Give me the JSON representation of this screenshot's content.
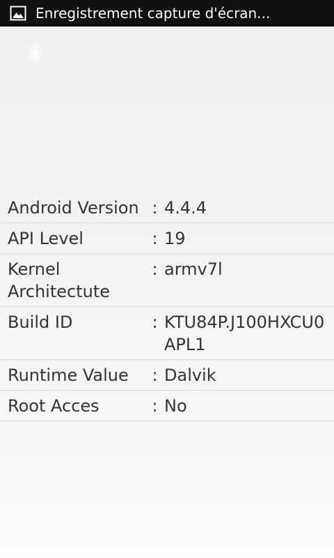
{
  "status_bar": {
    "notification_text": "Enregistrement capture d'écran...",
    "icon": "image-icon"
  },
  "info": {
    "separator": ":",
    "rows": [
      {
        "label": "Android Version",
        "value": "4.4.4"
      },
      {
        "label": "API Level",
        "value": "19"
      },
      {
        "label": "Kernel Architectute",
        "value": "armv7l"
      },
      {
        "label": "Build ID",
        "value": "KTU84P.J100HXCU0APL1"
      },
      {
        "label": "Runtime Value",
        "value": "Dalvik"
      },
      {
        "label": "Root Acces",
        "value": "No"
      }
    ]
  },
  "colors": {
    "status_bar_bg": "#101010",
    "text": "#333333",
    "divider": "#dcdcdc"
  }
}
